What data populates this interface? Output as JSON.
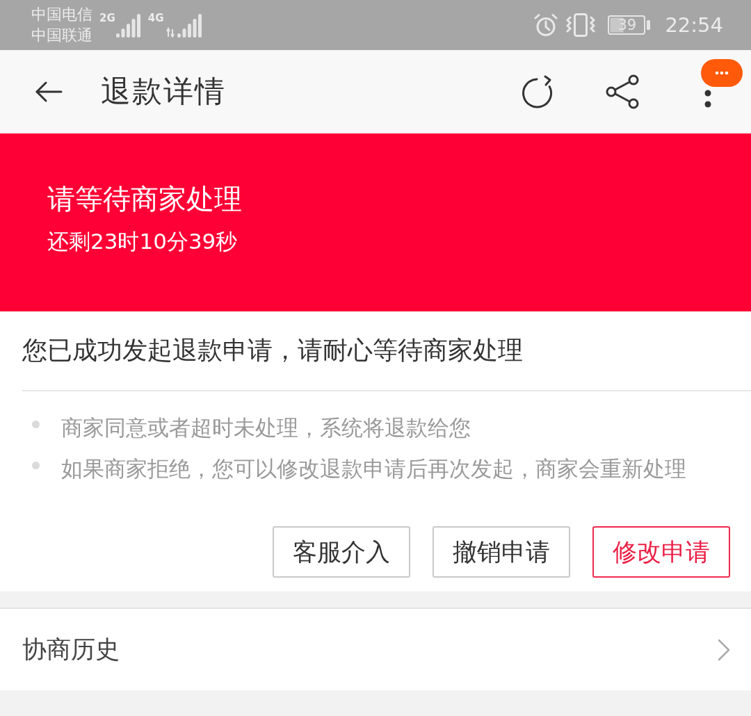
{
  "status_bar": {
    "carriers": [
      {
        "name": "中国电信",
        "network": "2G",
        "data_activity": false
      },
      {
        "name": "中国联通",
        "network": "4G",
        "data_activity": true
      }
    ],
    "battery": "39",
    "time": "22:54"
  },
  "header": {
    "title": "退款详情"
  },
  "banner": {
    "title": "请等待商家处理",
    "countdown": "还剩23时10分39秒"
  },
  "notice": {
    "message": "您已成功发起退款申请，请耐心等待商家处理",
    "tips": [
      "商家同意或者超时未处理，系统将退款给您",
      "如果商家拒绝，您可以修改退款申请后再次发起，商家会重新处理"
    ]
  },
  "actions": [
    {
      "label": "客服介入",
      "kind": "default"
    },
    {
      "label": "撤销申请",
      "kind": "default"
    },
    {
      "label": "修改申请",
      "kind": "primary"
    }
  ],
  "history": {
    "label": "协商历史"
  }
}
